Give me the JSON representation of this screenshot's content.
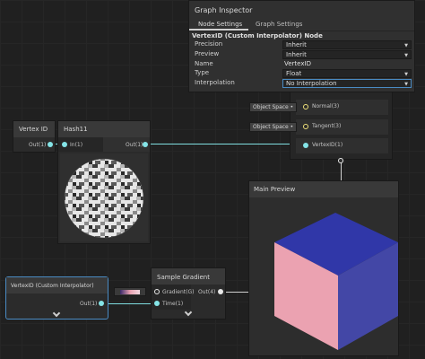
{
  "inspector": {
    "title": "Graph Inspector",
    "tabs": [
      "Node Settings",
      "Graph Settings"
    ],
    "node_title": "VertexID (Custom Interpolator) Node",
    "rows": [
      {
        "label": "Precision",
        "value": "Inherit",
        "dropdown": true
      },
      {
        "label": "Preview",
        "value": "Inherit",
        "dropdown": true
      },
      {
        "label": "Name",
        "value": "VertexID",
        "dropdown": false
      },
      {
        "label": "Type",
        "value": "Float",
        "dropdown": true
      },
      {
        "label": "Interpolation",
        "value": "No Interpolation",
        "dropdown": true
      }
    ]
  },
  "master_stack": {
    "slots": [
      "Normal(3)",
      "Tangent(3)",
      "VertexID(1)"
    ],
    "space_tags": [
      "Object Space",
      "Object Space"
    ]
  },
  "vertex_id_node": {
    "title": "Vertex ID",
    "out": "Out(1)"
  },
  "hash_node": {
    "title": "Hash11",
    "in": "In(1)",
    "out": "Out(1)"
  },
  "main_preview": {
    "title": "Main Preview"
  },
  "custom_interp_node": {
    "title": "VertexID (Custom Interpolator)",
    "out": "Out(1)"
  },
  "sample_gradient_node": {
    "title": "Sample Gradient",
    "in_gradient": "Gradient(G)",
    "in_time": "Time(1)",
    "out": "Out(4)"
  },
  "colors": {
    "cube_top": "#3037a8",
    "cube_right": "#4347a6",
    "cube_front": "#eba2b1",
    "port_cyan": "#84e4e7",
    "port_yellow": "#f0e27a",
    "selected_outline": "#4a8bc3"
  }
}
